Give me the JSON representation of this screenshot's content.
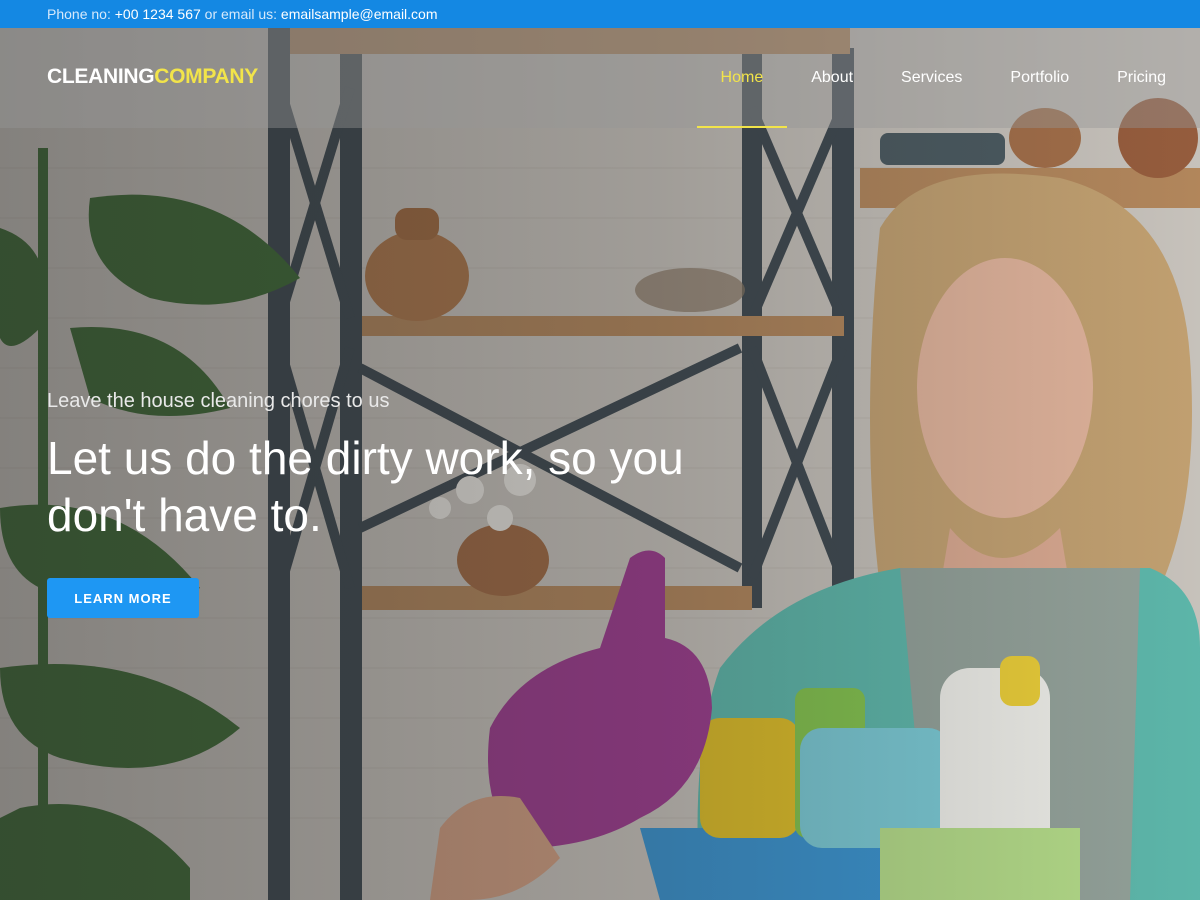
{
  "topbar": {
    "phone_label": "Phone no: ",
    "phone": "+00 1234 567",
    "email_label": " or email us: ",
    "email": "emailsample@email.com"
  },
  "brand": {
    "part1": "CLEANING",
    "part2": "COMPANY"
  },
  "nav": {
    "items": [
      {
        "label": "Home",
        "active": true
      },
      {
        "label": "About"
      },
      {
        "label": "Services"
      },
      {
        "label": "Portfolio"
      },
      {
        "label": "Pricing"
      }
    ]
  },
  "hero": {
    "tagline": "Leave the house cleaning chores to us",
    "headline": "Let us do the dirty work, so you don't have to.",
    "cta_label": "LEARN MORE"
  },
  "colors": {
    "topbar": "#1488e3",
    "accent_yellow": "#f2e44a",
    "button_blue": "#1e97f3"
  }
}
